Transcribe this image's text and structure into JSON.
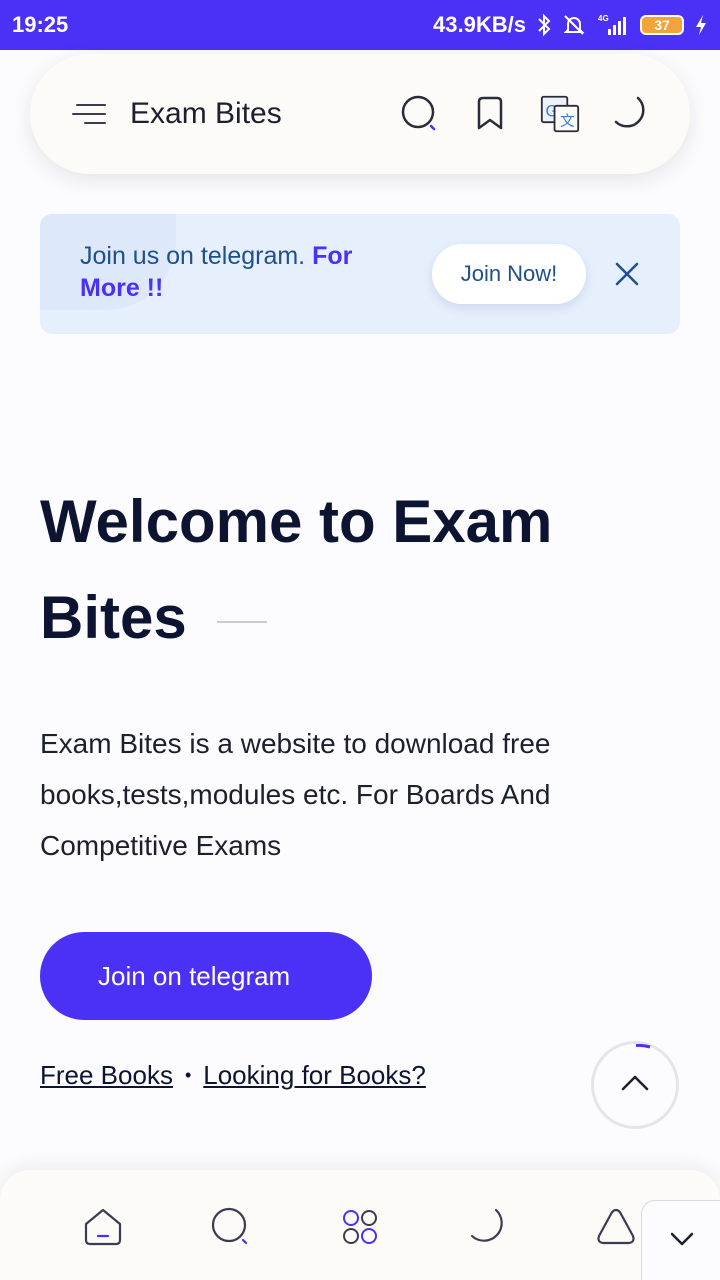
{
  "status_bar": {
    "time": "19:25",
    "net_speed": "43.9KB/s",
    "network": "4G",
    "battery": "37"
  },
  "header": {
    "title": "Exam Bites",
    "icons": [
      "menu-icon",
      "search-icon",
      "bookmark-icon",
      "translate-icon",
      "dark-mode-icon"
    ]
  },
  "banner": {
    "text": "Join us on telegram.",
    "highlight": "For More !!",
    "button_label": "Join Now!"
  },
  "hero": {
    "title": "Welcome to Exam Bites",
    "description": "Exam Bites is a website to download free books,tests,modules etc. For Boards And Competitive Exams",
    "cta_label": "Join on telegram",
    "link_1": "Free Books",
    "separator": "•",
    "link_2": "Looking for Books?"
  },
  "bottom_nav": {
    "icons": [
      "home-icon",
      "search-icon",
      "grid-icon",
      "dark-mode-icon",
      "top-icon"
    ]
  },
  "colors": {
    "accent": "#4a31f5",
    "banner_bg": "#e6effc",
    "banner_text": "#1e4f8e",
    "heading": "#0c1431"
  }
}
